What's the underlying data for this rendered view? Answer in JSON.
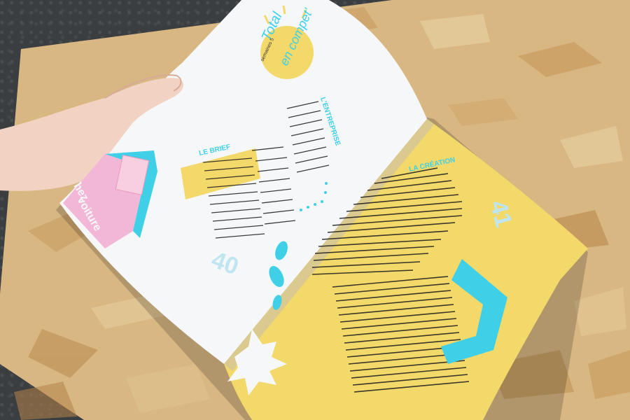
{
  "magazine": {
    "left_page": {
      "title_line1": "Total",
      "title_line2": "en compet'",
      "subtitle": "semaines 5",
      "section_brief": "LE BRIEF",
      "section_entreprise": "L'ENTREPRISE",
      "page_number": "40",
      "side_tab_text_1": "hez",
      "side_tab_text_2": "voiture"
    },
    "right_page": {
      "section_creation": "LA CRÉATION",
      "page_number": "41"
    }
  },
  "colors": {
    "yellow": "#f3d86a",
    "cyan": "#3fd0e8",
    "pink": "#f2b7d6",
    "white_page": "#f6f7f8",
    "wood": "#d9b884",
    "asphalt": "#3b3e41"
  }
}
